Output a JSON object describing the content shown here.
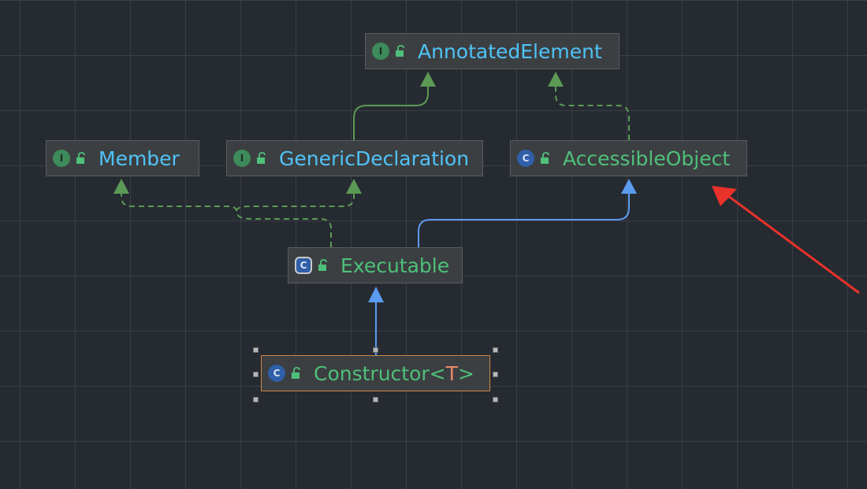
{
  "nodes": {
    "annotated_element": {
      "label": "AnnotatedElement",
      "kind": "I"
    },
    "member": {
      "label": "Member",
      "kind": "I"
    },
    "generic_declaration": {
      "label": "GenericDeclaration",
      "kind": "I"
    },
    "accessible_object": {
      "label": "AccessibleObject",
      "kind": "C"
    },
    "executable": {
      "label": "Executable",
      "kind": "C"
    },
    "constructor": {
      "label": "Constructor",
      "kind": "C",
      "type_open": "<",
      "type_param": "T",
      "type_close": ">"
    }
  },
  "colors": {
    "interface_text": "#4fc3f7",
    "class_text": "#4ec07a",
    "implements_edge": "#5b9a55",
    "extends_edge": "#5b9bf0",
    "selection_border": "#c9874a",
    "annotation_arrow": "#e8322a"
  },
  "edges": [
    {
      "from": "Executable",
      "to": "Member",
      "style": "dashed",
      "relation": "implements"
    },
    {
      "from": "Executable",
      "to": "GenericDeclaration",
      "style": "dashed",
      "relation": "implements"
    },
    {
      "from": "Executable",
      "to": "AccessibleObject",
      "style": "solid",
      "relation": "extends"
    },
    {
      "from": "GenericDeclaration",
      "to": "AnnotatedElement",
      "style": "solid",
      "relation": "extends"
    },
    {
      "from": "AccessibleObject",
      "to": "AnnotatedElement",
      "style": "dashed",
      "relation": "implements"
    },
    {
      "from": "Constructor",
      "to": "Executable",
      "style": "solid",
      "relation": "extends"
    }
  ],
  "selected_node": "Constructor"
}
